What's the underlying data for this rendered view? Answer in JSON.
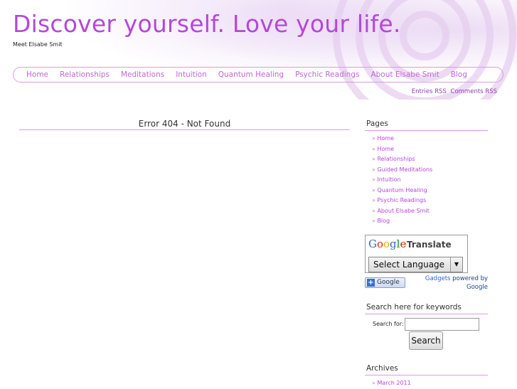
{
  "header": {
    "title": "Discover yourself. Love your life.",
    "description": "Meet Elsabe Smit"
  },
  "nav": {
    "items": [
      "Home",
      "Relationships",
      "Meditations",
      "Intuition",
      "Quantum Healing",
      "Psychic Readings",
      "About Elsabe Smit",
      "Blog"
    ]
  },
  "rss": {
    "entries": "Entries RSS",
    "comments": "Comments RSS"
  },
  "content": {
    "heading": "Error 404 - Not Found"
  },
  "sidebar": {
    "pages_title": "Pages",
    "pages": [
      "Home",
      "Home",
      "Relationships",
      "Guided Meditations",
      "Intuition",
      "Quantum Healing",
      "Psychic Readings",
      "About Elsabe Smit",
      "Blog"
    ],
    "translate": {
      "logo": "Google",
      "label": "Translate",
      "select_value": "Select Language",
      "add_button": "Google",
      "gadgets": "Gadgets",
      "powered_by": "powered by",
      "google": "Google"
    },
    "search": {
      "title": "Search here for keywords",
      "label": "Search for:",
      "value": "",
      "button": "Search"
    },
    "archives": {
      "title": "Archives",
      "items": [
        "March 2011"
      ]
    }
  },
  "colors": {
    "accent": "#b547d8",
    "border": "#d89be8"
  }
}
